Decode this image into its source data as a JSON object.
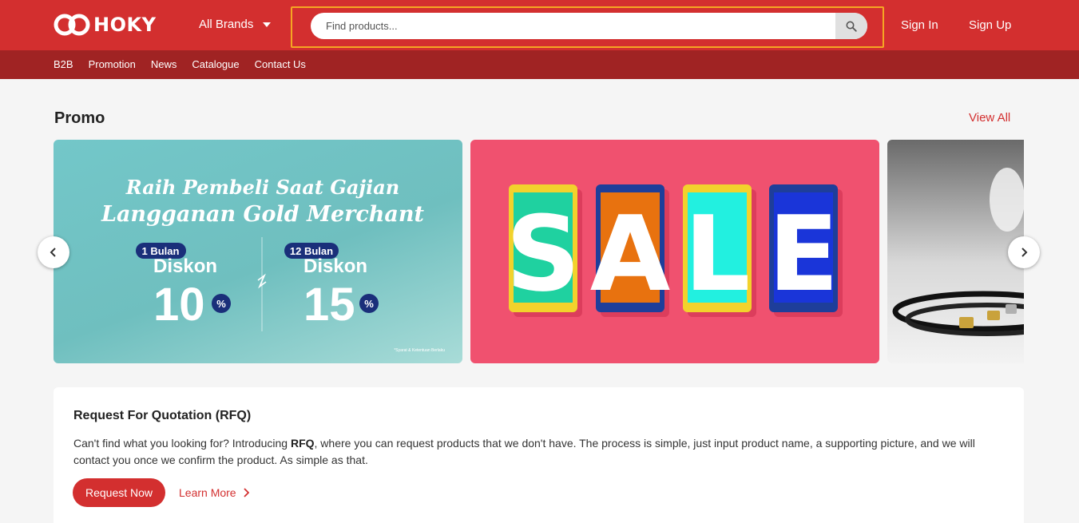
{
  "header": {
    "logo_text": "HOKY",
    "brands_label": "All Brands",
    "search_placeholder": "Find products...",
    "signin_label": "Sign In",
    "signup_label": "Sign Up"
  },
  "subnav": [
    "B2B",
    "Promotion",
    "News",
    "Catalogue",
    "Contact Us"
  ],
  "promo": {
    "title": "Promo",
    "view_all": "View All",
    "banner1": {
      "line1": "Raih Pembeli Saat Gajian",
      "line2": "Langganan Gold Merchant",
      "left_tag": "1 Bulan",
      "left_label": "Diskon",
      "left_value": "10",
      "right_tag": "12 Bulan",
      "right_label": "Diskon",
      "right_value": "15",
      "percent": "%",
      "note": "*Syarat & Ketentuan Berlaku"
    },
    "banner2": {
      "letters": [
        "S",
        "A",
        "L",
        "E"
      ]
    }
  },
  "rfq": {
    "title": "Request For Quotation (RFQ)",
    "desc_before": "Can't find what you looking for? Introducing ",
    "desc_bold": "RFQ",
    "desc_after": ", where you can request products that we don't have. The process is simple, just input product name, a supporting picture, and we will contact you once we confirm the product. As simple as that.",
    "request_button": "Request Now",
    "learn_more": "Learn More"
  },
  "colors": {
    "brand_red": "#d32f2f",
    "dark_red": "#a02323",
    "highlight_outline": "#f5a623"
  },
  "icons": {
    "search": "search-icon",
    "caret": "caret-down-icon",
    "prev": "chevron-left-icon",
    "next": "chevron-right-icon",
    "learn_more": "chevron-right-icon"
  }
}
